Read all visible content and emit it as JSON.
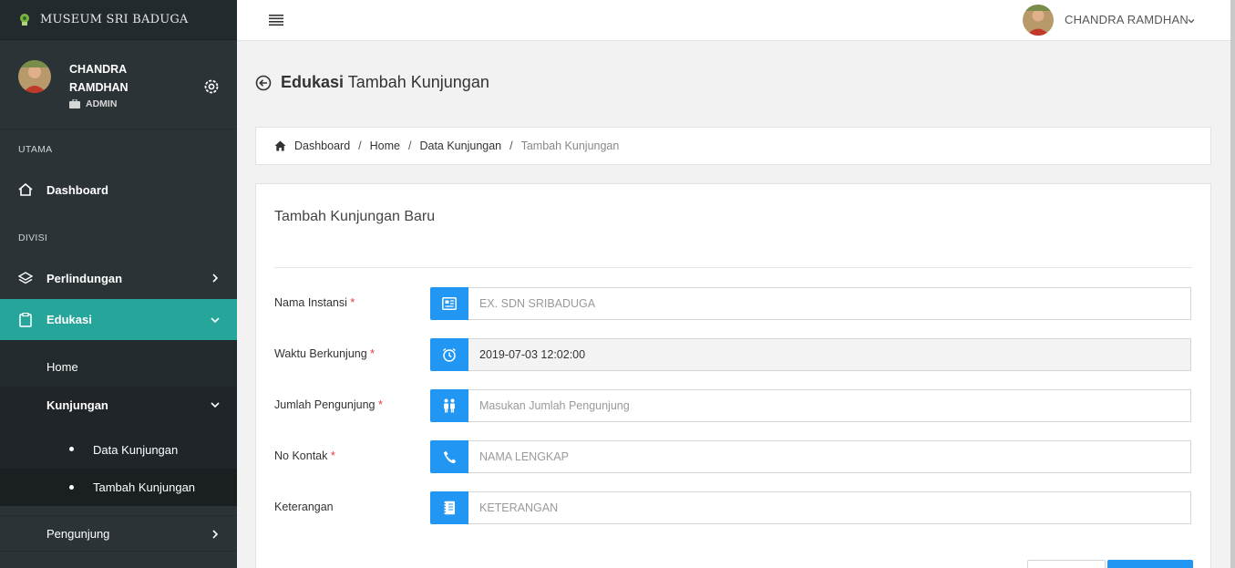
{
  "brand": {
    "name": "MUSEUM SRI BADUGA"
  },
  "user": {
    "name": "CHANDRA RAMDHAN",
    "role": "ADMIN"
  },
  "sidebar": {
    "section_main": "UTAMA",
    "dashboard": "Dashboard",
    "section_division": "DIVISI",
    "perlindungan": "Perlindungan",
    "edukasi": "Edukasi",
    "home": "Home",
    "kunjungan": "Kunjungan",
    "data_kunjungan": "Data Kunjungan",
    "tambah_kunjungan": "Tambah Kunjungan",
    "pengunjung": "Pengunjung"
  },
  "topbar": {
    "user_name": "CHANDRA RAMDHAN"
  },
  "page": {
    "title_bold": "Edukasi",
    "title_rest": "Tambah Kunjungan"
  },
  "breadcrumb": {
    "items": [
      "Dashboard",
      "Home",
      "Data Kunjungan"
    ],
    "current": "Tambah Kunjungan"
  },
  "form": {
    "title": "Tambah Kunjungan Baru",
    "fields": [
      {
        "label": "Nama Instansi",
        "required": "*",
        "value": "",
        "placeholder": "EX. SDN SRIBADUGA",
        "icon": "id-card-icon"
      },
      {
        "label": "Waktu Berkunjung",
        "required": "*",
        "value": "2019-07-03 12:02:00",
        "placeholder": "",
        "icon": "alarm-clock-icon"
      },
      {
        "label": "Jumlah Pengunjung",
        "required": "*",
        "value": "",
        "placeholder": "Masukan Jumlah Pengunjung",
        "icon": "people-icon"
      },
      {
        "label": "No Kontak",
        "required": "*",
        "value": "",
        "placeholder": "NAMA LENGKAP",
        "icon": "phone-icon"
      },
      {
        "label": "Keterangan",
        "required": "",
        "value": "",
        "placeholder": "KETERANGAN",
        "icon": "notebook-icon"
      }
    ]
  },
  "colors": {
    "sidebar": "#2b3337",
    "active": "#26a69a",
    "primary": "#2196f3",
    "required": "#e53935"
  }
}
